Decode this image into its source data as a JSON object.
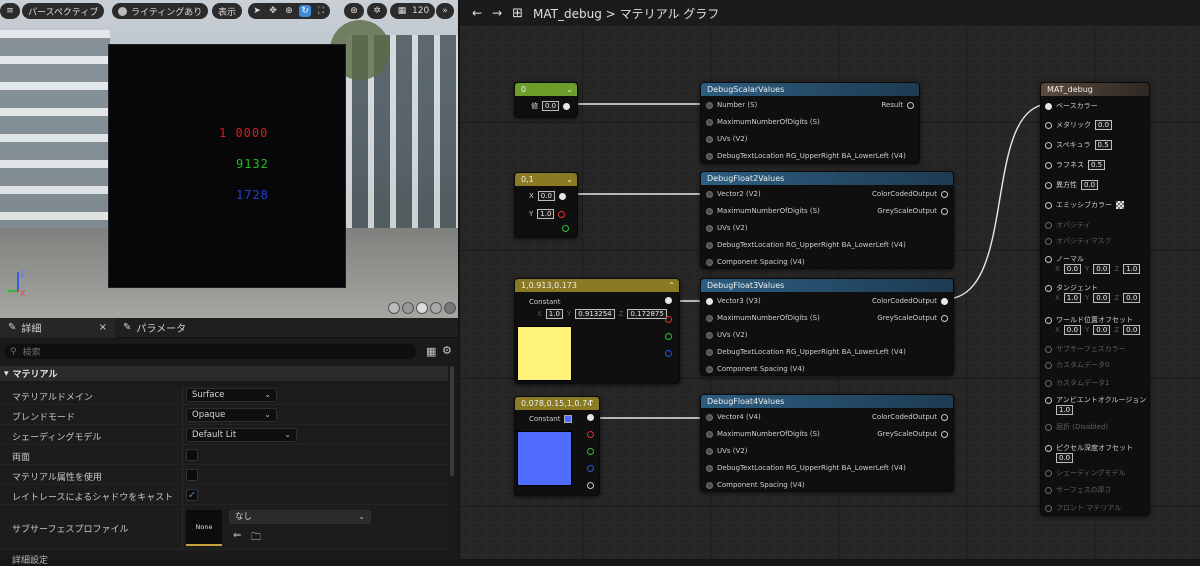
{
  "viewport": {
    "toolbar": {
      "perspective": "パースペクティブ",
      "lighting": "ライティングあり",
      "show": "表示",
      "fov": "120"
    },
    "debug_lines": [
      {
        "text": "1 0000",
        "color": "#d02020"
      },
      {
        "text": "9132",
        "color": "#20c020"
      },
      {
        "text": "1728",
        "color": "#2040d0"
      }
    ],
    "axes": {
      "z": "Z",
      "y": "Y",
      "x": "X"
    }
  },
  "details": {
    "tabs": [
      {
        "label": "詳細"
      },
      {
        "label": "パラメータ"
      }
    ],
    "close_glyph": "×",
    "search_placeholder": "検索",
    "category": "マテリアル",
    "rows": [
      {
        "label": "マテリアルドメイン",
        "value": "Surface"
      },
      {
        "label": "ブレンドモード",
        "value": "Opaque"
      },
      {
        "label": "シェーディングモデル",
        "value": "Default Lit"
      },
      {
        "label": "両面",
        "checked": false
      },
      {
        "label": "マテリアル属性を使用",
        "checked": false
      },
      {
        "label": "レイトレースによるシャドウをキャスト",
        "checked": true
      },
      {
        "label": "サブサーフェスプロファイル",
        "value": "なし",
        "thumb": "None"
      }
    ],
    "footer": "詳細設定"
  },
  "graph": {
    "breadcrumb": {
      "asset": "MAT_debug",
      "separator": ">",
      "graph": "マテリアル グラフ"
    },
    "nodes": {
      "scalar": {
        "title": "0",
        "pin_label": "値",
        "value": "0.0"
      },
      "vec2": {
        "title": "0,1",
        "x_label": "X",
        "x": "0.0",
        "y_label": "Y",
        "y": "1.0"
      },
      "vec3": {
        "title": "1,0.913,0.173",
        "label": "Constant",
        "x_label": "X",
        "x": "1.0",
        "y_label": "Y",
        "y": "0.913254",
        "z_label": "Z",
        "z": "0.172875",
        "swatch": "#fff27a"
      },
      "vec4": {
        "title": "0.078,0.15,1,0.74",
        "label": "Constant",
        "swatch": "#4f6cff"
      },
      "dsv": {
        "title": "DebugScalarValues",
        "inputs": [
          "Number (S)",
          "MaximumNumberOfDigits (S)",
          "UVs (V2)",
          "DebugTextLocation RG_UpperRight BA_LowerLeft (V4)"
        ],
        "outputs": [
          "Result"
        ]
      },
      "df2": {
        "title": "DebugFloat2Values",
        "inputs": [
          "Vector2 (V2)",
          "MaximumNumberOfDigits (S)",
          "UVs (V2)",
          "DebugTextLocation RG_UpperRight BA_LowerLeft (V4)",
          "Component Spacing (V4)"
        ],
        "outputs": [
          "ColorCodedOutput",
          "GreyScaleOutput"
        ]
      },
      "df3": {
        "title": "DebugFloat3Values",
        "inputs": [
          "Vector3 (V3)",
          "MaximumNumberOfDigits (S)",
          "UVs (V2)",
          "DebugTextLocation RG_UpperRight BA_LowerLeft (V4)",
          "Component Spacing (V4)"
        ],
        "outputs": [
          "ColorCodedOutput",
          "GreyScaleOutput"
        ]
      },
      "df4": {
        "title": "DebugFloat4Values",
        "inputs": [
          "Vector4 (V4)",
          "MaximumNumberOfDigits (S)",
          "UVs (V2)",
          "DebugTextLocation RG_UpperRight BA_LowerLeft (V4)",
          "Component Spacing (V4)"
        ],
        "outputs": [
          "ColorCodedOutput",
          "GreyScaleOutput"
        ]
      },
      "result": {
        "title": "MAT_debug",
        "pins": [
          {
            "label": "ベースカラー",
            "enabled": true
          },
          {
            "label": "メタリック",
            "value": "0.0",
            "enabled": true
          },
          {
            "label": "スペキュラ",
            "value": "0.5",
            "enabled": true
          },
          {
            "label": "ラフネス",
            "value": "0.5",
            "enabled": true
          },
          {
            "label": "異方性",
            "value": "0.0",
            "enabled": true
          },
          {
            "label": "エミッシブカラー",
            "enabled": true
          },
          {
            "label": "オパシティ",
            "enabled": false
          },
          {
            "label": "オパシティマスク",
            "enabled": false
          },
          {
            "label": "ノーマル",
            "enabled": true
          },
          {
            "label": "タンジェント",
            "enabled": true
          },
          {
            "label": "ワールド位置オフセット",
            "enabled": true
          },
          {
            "label": "サブサーフェスカラー",
            "enabled": false
          },
          {
            "label": "カスタムデータ0",
            "enabled": false
          },
          {
            "label": "カスタムデータ1",
            "enabled": false
          },
          {
            "label": "アンビエントオクルージョン",
            "value": "1.0",
            "enabled": true
          },
          {
            "label": "屈折 (Disabled)",
            "enabled": false
          },
          {
            "label": "ピクセル深度オフセット",
            "value": "0.0",
            "enabled": true
          },
          {
            "label": "シェーディングモデル",
            "enabled": false
          },
          {
            "label": "サーフェスの厚さ",
            "enabled": false
          },
          {
            "label": "フロント マテリアル",
            "enabled": false
          }
        ],
        "normal": {
          "x": "0.0",
          "y": "0.0",
          "z": "1.0"
        },
        "tangent": {
          "x": "1.0",
          "y": "0.0",
          "z": "0.0"
        },
        "wpo": {
          "x": "0.0",
          "y": "0.0",
          "z": "0.0"
        },
        "axis_x": "X",
        "axis_y": "Y",
        "axis_z": "Z"
      }
    }
  }
}
